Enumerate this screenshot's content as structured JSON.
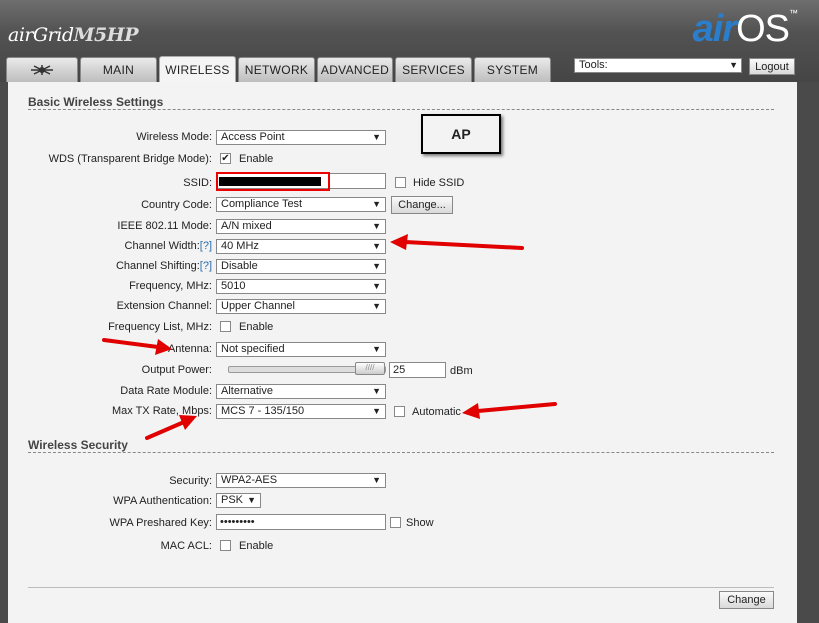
{
  "brand": {
    "name": "airGrid",
    "model": "M5HP"
  },
  "logo": {
    "air": "air",
    "os": "OS",
    "tm": "™"
  },
  "tabs": [
    {
      "label": ""
    },
    {
      "label": "MAIN"
    },
    {
      "label": "WIRELESS"
    },
    {
      "label": "NETWORK"
    },
    {
      "label": "ADVANCED"
    },
    {
      "label": "SERVICES"
    },
    {
      "label": "SYSTEM"
    }
  ],
  "tools": {
    "label": "Tools:"
  },
  "logout_label": "Logout",
  "basic": {
    "title": "Basic Wireless Settings",
    "wireless_mode": {
      "label": "Wireless Mode:",
      "value": "Access Point"
    },
    "wds": {
      "label": "WDS (Transparent Bridge Mode):",
      "check": "✔",
      "option": "Enable"
    },
    "ssid": {
      "label": "SSID:",
      "hide_label": "Hide SSID"
    },
    "country": {
      "label": "Country Code:",
      "value": "Compliance Test",
      "button": "Change..."
    },
    "ieee": {
      "label": "IEEE 802.11 Mode:",
      "value": "A/N mixed"
    },
    "channel_width": {
      "label": "Channel Width:",
      "help": "[?]",
      "value": "40 MHz"
    },
    "channel_shift": {
      "label": "Channel Shifting:",
      "help": "[?]",
      "value": "Disable"
    },
    "frequency": {
      "label": "Frequency, MHz:",
      "value": "5010"
    },
    "ext_channel": {
      "label": "Extension Channel:",
      "value": "Upper Channel"
    },
    "freq_list": {
      "label": "Frequency List, MHz:",
      "option": "Enable"
    },
    "antenna": {
      "label": "Antenna:",
      "value": "Not specified"
    },
    "output_power": {
      "label": "Output Power:",
      "value": "25",
      "unit": "dBm",
      "grip": "////"
    },
    "data_rate": {
      "label": "Data Rate Module:",
      "value": "Alternative"
    },
    "max_tx": {
      "label": "Max TX Rate, Mbps:",
      "value": "MCS 7 - 135/150",
      "auto": "Automatic"
    }
  },
  "annotation": {
    "ap": "AP"
  },
  "security": {
    "title": "Wireless Security",
    "security": {
      "label": "Security:",
      "value": "WPA2-AES"
    },
    "wpa_auth": {
      "label": "WPA Authentication:",
      "value": "PSK"
    },
    "wpa_key": {
      "label": "WPA Preshared Key:",
      "value": "•••••••••",
      "show": "Show"
    },
    "mac_acl": {
      "label": "MAC ACL:",
      "option": "Enable"
    }
  },
  "change_label": "Change",
  "dropdown_arrow": "▼",
  "colors": {
    "accent": "#2a7ecb",
    "annotation_red": "#e00000",
    "header": "#555555",
    "panel": "#f3f3f3"
  }
}
